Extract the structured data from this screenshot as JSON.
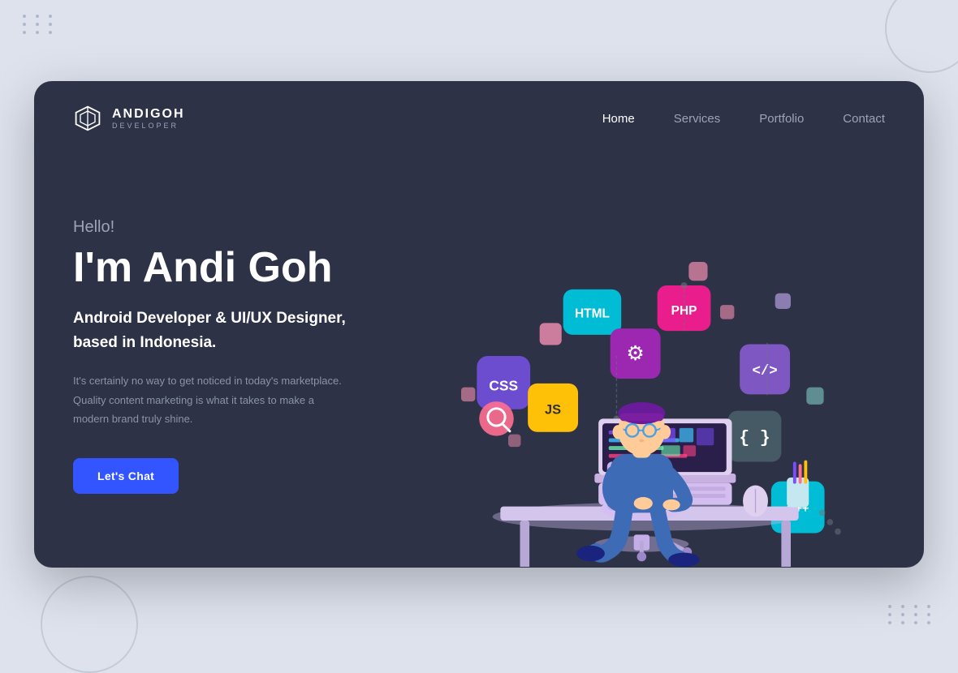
{
  "page": {
    "background_color": "#dde2ed"
  },
  "logo": {
    "name": "ANDIGOH",
    "subtitle": "DEVELOPER"
  },
  "nav": {
    "links": [
      {
        "label": "Home",
        "active": true
      },
      {
        "label": "Services",
        "active": false
      },
      {
        "label": "Portfolio",
        "active": false
      },
      {
        "label": "Contact",
        "active": false
      }
    ]
  },
  "hero": {
    "greeting": "Hello!",
    "name": "I'm Andi Goh",
    "role": "Android Developer & UI/UX Designer,\nbased in Indonesia.",
    "description": "It's certainly no way to get noticed in today's marketplace. Quality content marketing is what it takes to make a modern brand truly shine.",
    "cta_button": "Let's Chat"
  }
}
